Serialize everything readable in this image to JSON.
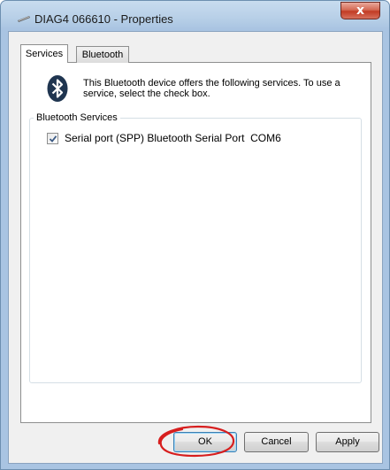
{
  "window": {
    "title": "DIAG4 066610 - Properties",
    "close_label": "x"
  },
  "tabs": [
    {
      "label": "Services",
      "selected": true
    },
    {
      "label": "Bluetooth",
      "selected": false
    }
  ],
  "services_panel": {
    "description_line1": "This Bluetooth device offers the following services. To use a",
    "description_line2": "service, select the check box.",
    "group_label": "Bluetooth Services",
    "services": [
      {
        "label": "Serial port (SPP) Bluetooth Serial Port  COM6",
        "checked": true
      }
    ]
  },
  "buttons": {
    "ok": "OK",
    "cancel": "Cancel",
    "apply": "Apply"
  },
  "colors": {
    "highlight_circle": "#d71e1e",
    "bluetooth_icon": "#1f3550"
  },
  "icons": {
    "title": "bluetooth-device-icon",
    "description": "bluetooth-icon"
  }
}
